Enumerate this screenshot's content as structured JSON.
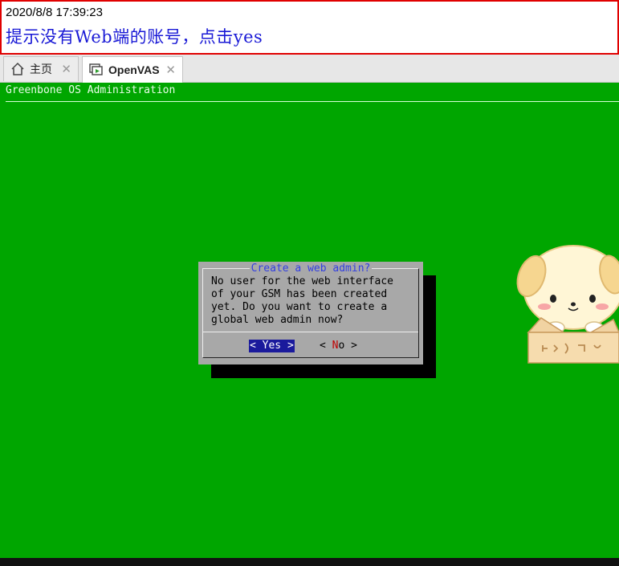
{
  "annotation": {
    "timestamp": "2020/8/8 17:39:23",
    "message": "提示没有Web端的账号，点击yes"
  },
  "tabs": [
    {
      "label": "主页",
      "icon": "home-icon",
      "active": false
    },
    {
      "label": "OpenVAS",
      "icon": "vm-running-icon",
      "active": true
    }
  ],
  "console": {
    "header": "Greenbone OS Administration",
    "background": "#00a600"
  },
  "dialog": {
    "title": "Create a web admin?",
    "body": "No user for the web interface\nof your GSM has been created\nyet. Do you want to create a\nglobal web admin now?",
    "yes_label": "< Yes >",
    "no_prefix": "< ",
    "no_hotkey": "N",
    "no_rest": "o  >"
  }
}
